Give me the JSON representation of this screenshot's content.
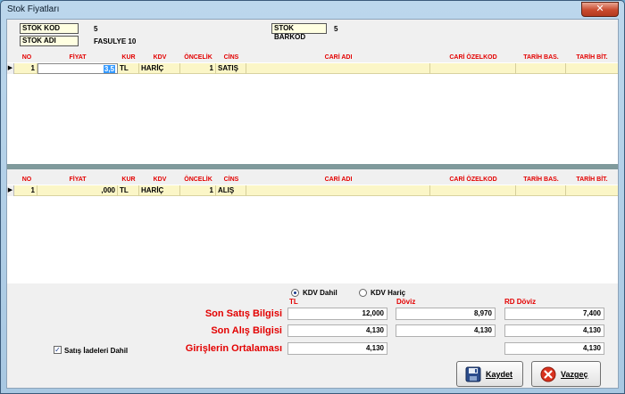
{
  "window": {
    "title": "Stok Fiyatları",
    "close_glyph": "✕"
  },
  "header": {
    "stok_kod_label": "STOK KOD",
    "stok_kod_value": "5",
    "stok_adi_label": "STOK ADI",
    "stok_adi_value": "FASULYE 10",
    "stok_barkod_label": "STOK BARKOD",
    "stok_barkod_value": "5"
  },
  "columns": [
    "NO",
    "FİYAT",
    "KUR",
    "KDV",
    "ÖNCELİK",
    "CİNS",
    "CARİ ADI",
    "CARİ ÖZELKOD",
    "TARİH BAS.",
    "TARİH BİT."
  ],
  "grid_top": {
    "row": {
      "no": "1",
      "fiyat": "3,5",
      "kur": "TL",
      "kdv": "HARİÇ",
      "oncelik": "1",
      "cins": "SATIŞ",
      "cari_adi": "",
      "cari_ozelkod": "",
      "tarih_bas": "",
      "tarih_bit": ""
    }
  },
  "grid_bottom": {
    "row": {
      "no": "1",
      "fiyat": ",000",
      "kur": "TL",
      "kdv": "HARİÇ",
      "oncelik": "1",
      "cins": "ALIŞ",
      "cari_adi": "",
      "cari_ozelkod": "",
      "tarih_bas": "",
      "tarih_bit": ""
    }
  },
  "summary": {
    "kdv_dahil": "KDV Dahil",
    "kdv_haric": "KDV Hariç",
    "col_tl": "TL",
    "col_doviz": "Döviz",
    "col_rd_doviz": "RD Döviz",
    "son_satis_label": "Son Satış Bilgisi",
    "son_alis_label": "Son Alış Bilgisi",
    "girisler_label": "Girişlerin Ortalaması",
    "son_satis": {
      "tl": "12,000",
      "doviz": "8,970",
      "rd_doviz": "7,400"
    },
    "son_alis": {
      "tl": "4,130",
      "doviz": "4,130",
      "rd_doviz": "4,130"
    },
    "girisler": {
      "tl": "4,130",
      "rd_doviz": "4,130"
    },
    "satis_iadeleri_label": "Satış İadeleri Dahil"
  },
  "buttons": {
    "kaydet": "Kaydet",
    "vazgec": "Vazgeç"
  },
  "colors": {
    "accent_red": "#e30000",
    "row_yellow": "#fbf6c7"
  }
}
